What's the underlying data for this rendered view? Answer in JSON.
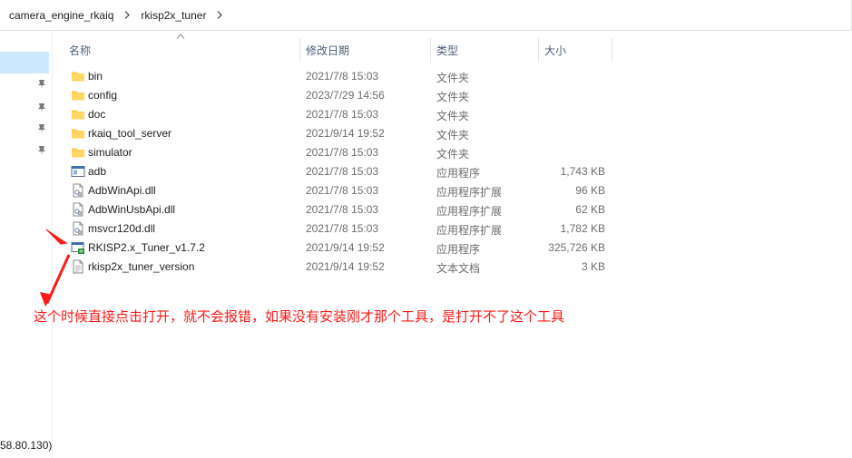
{
  "breadcrumb": [
    "camera_engine_rkaiq",
    "rkisp2x_tuner"
  ],
  "nav": {
    "ip_text": "58.80.130)"
  },
  "columns": {
    "name": "名称",
    "modified": "修改日期",
    "type": "类型",
    "size": "大小"
  },
  "files": [
    {
      "name": "bin",
      "modified": "2021/7/8 15:03",
      "type": "文件夹",
      "size": "",
      "icon": "folder-icon"
    },
    {
      "name": "config",
      "modified": "2023/7/29 14:56",
      "type": "文件夹",
      "size": "",
      "icon": "folder-icon"
    },
    {
      "name": "doc",
      "modified": "2021/7/8 15:03",
      "type": "文件夹",
      "size": "",
      "icon": "folder-icon"
    },
    {
      "name": "rkaiq_tool_server",
      "modified": "2021/9/14 19:52",
      "type": "文件夹",
      "size": "",
      "icon": "folder-icon"
    },
    {
      "name": "simulator",
      "modified": "2021/7/8 15:03",
      "type": "文件夹",
      "size": "",
      "icon": "folder-icon"
    },
    {
      "name": "adb",
      "modified": "2021/7/8 15:03",
      "type": "应用程序",
      "size": "1,743 KB",
      "icon": "application-icon"
    },
    {
      "name": "AdbWinApi.dll",
      "modified": "2021/7/8 15:03",
      "type": "应用程序扩展",
      "size": "96 KB",
      "icon": "dll-icon"
    },
    {
      "name": "AdbWinUsbApi.dll",
      "modified": "2021/7/8 15:03",
      "type": "应用程序扩展",
      "size": "62 KB",
      "icon": "dll-icon"
    },
    {
      "name": "msvcr120d.dll",
      "modified": "2021/7/8 15:03",
      "type": "应用程序扩展",
      "size": "1,782 KB",
      "icon": "dll-icon"
    },
    {
      "name": "RKISP2.x_Tuner_v1.7.2",
      "modified": "2021/9/14 19:52",
      "type": "应用程序",
      "size": "325,726 KB",
      "icon": "tuner-app-icon"
    },
    {
      "name": "rkisp2x_tuner_version",
      "modified": "2021/9/14 19:52",
      "type": "文本文档",
      "size": "3 KB",
      "icon": "text-document-icon"
    }
  ],
  "annotation": "这个时候直接点击打开，就不会报错，如果没有安装刚才那个工具，是打开不了这个工具",
  "colors": {
    "selection": "#cce8ff",
    "folder": "#ffc83d",
    "annotation": "#ff1a1a",
    "header_text": "#4c607a"
  }
}
